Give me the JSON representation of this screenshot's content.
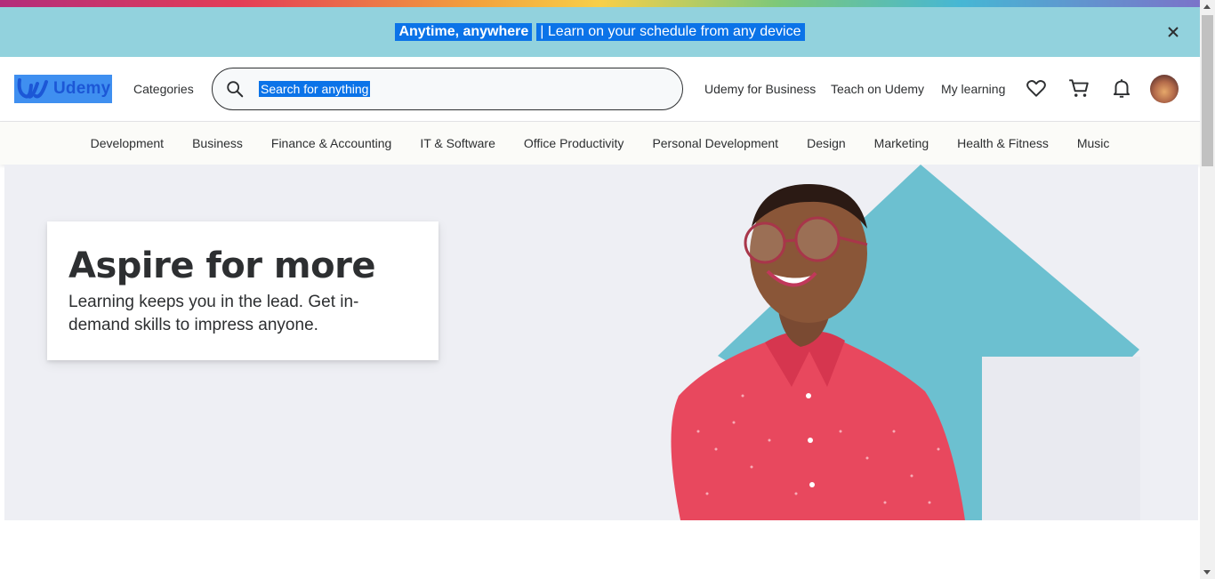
{
  "banner": {
    "highlight": "Anytime, anywhere",
    "text": "| Learn on your schedule from any device",
    "close_icon": "close-icon"
  },
  "header": {
    "logo_text": "Udemy",
    "categories_label": "Categories",
    "search_placeholder": "Search for anything",
    "links": [
      "Udemy for Business",
      "Teach on Udemy",
      "My learning"
    ],
    "icons": [
      "heart-icon",
      "cart-icon",
      "bell-icon",
      "avatar"
    ]
  },
  "categories": [
    "Development",
    "Business",
    "Finance & Accounting",
    "IT & Software",
    "Office Productivity",
    "Personal Development",
    "Design",
    "Marketing",
    "Health & Fitness",
    "Music"
  ],
  "hero": {
    "title": "Aspire for more",
    "subtitle": "Learning keeps you in the lead. Get in-demand skills to impress anyone."
  },
  "colors": {
    "banner_bg": "#92d2dd",
    "selection": "#0b73e8",
    "hero_bg": "#eeeff4",
    "arrow": "#6cc0d0",
    "shirt": "#e8485e"
  }
}
